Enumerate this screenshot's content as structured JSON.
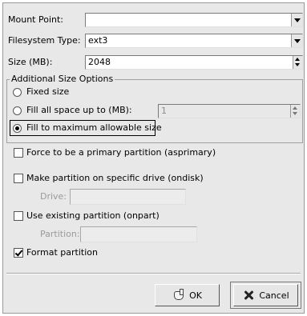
{
  "mount_point": {
    "label": "Mount Point:",
    "value": ""
  },
  "filesystem": {
    "label": "Filesystem Type:",
    "value": "ext3"
  },
  "size": {
    "label": "Size (MB):",
    "value": "2048"
  },
  "size_options": {
    "title": "Additional Size Options",
    "fixed_label": "Fixed size",
    "fill_upto_label": "Fill all space up to (MB):",
    "fill_upto_value": "1",
    "fill_max_label": "Fill to maximum allowable size",
    "selected": "fill_max"
  },
  "force_primary": {
    "label": "Force to be a primary partition (asprimary)",
    "checked": false
  },
  "specific_drive": {
    "label": "Make partition on specific drive (ondisk)",
    "checked": false,
    "drive_label": "Drive:",
    "drive_value": ""
  },
  "existing_partition": {
    "label": "Use existing partition (onpart)",
    "checked": false,
    "partition_label": "Partition:",
    "partition_value": ""
  },
  "format_partition": {
    "label": "Format partition",
    "checked": true
  },
  "buttons": {
    "ok_label": "OK",
    "cancel_label": "Cancel"
  },
  "icons": {
    "ok": "hand-pointer-icon",
    "cancel": "x-cross-icon",
    "dropdown": "chevron-down-icon",
    "spin": "spin-arrows-icon"
  }
}
